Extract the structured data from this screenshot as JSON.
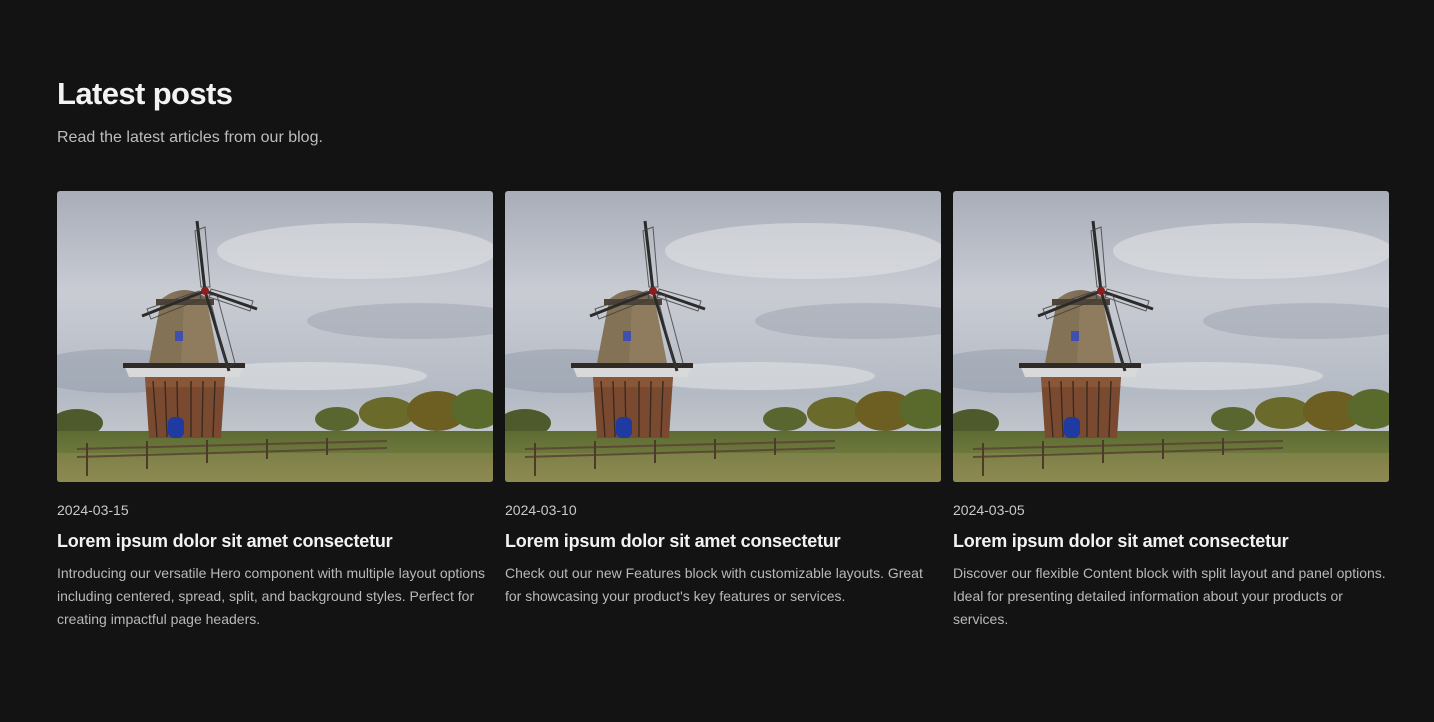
{
  "header": {
    "title": "Latest posts",
    "subtitle": "Read the latest articles from our blog."
  },
  "posts": [
    {
      "date": "2024-03-15",
      "title": "Lorem ipsum dolor sit amet consectetur",
      "excerpt": "Introducing our versatile Hero component with multiple layout options including centered, spread, split, and background styles. Perfect for creating impactful page headers.",
      "image": "windmill-photo"
    },
    {
      "date": "2024-03-10",
      "title": "Lorem ipsum dolor sit amet consectetur",
      "excerpt": "Check out our new Features block with customizable layouts. Great for showcasing your product's key features or services.",
      "image": "windmill-photo"
    },
    {
      "date": "2024-03-05",
      "title": "Lorem ipsum dolor sit amet consectetur",
      "excerpt": "Discover our flexible Content block with split layout and panel options. Ideal for presenting detailed information about your products or services.",
      "image": "windmill-photo"
    }
  ],
  "colors": {
    "background": "#131313",
    "heading": "#f3f3f3",
    "body_text": "#b9b9b9"
  }
}
